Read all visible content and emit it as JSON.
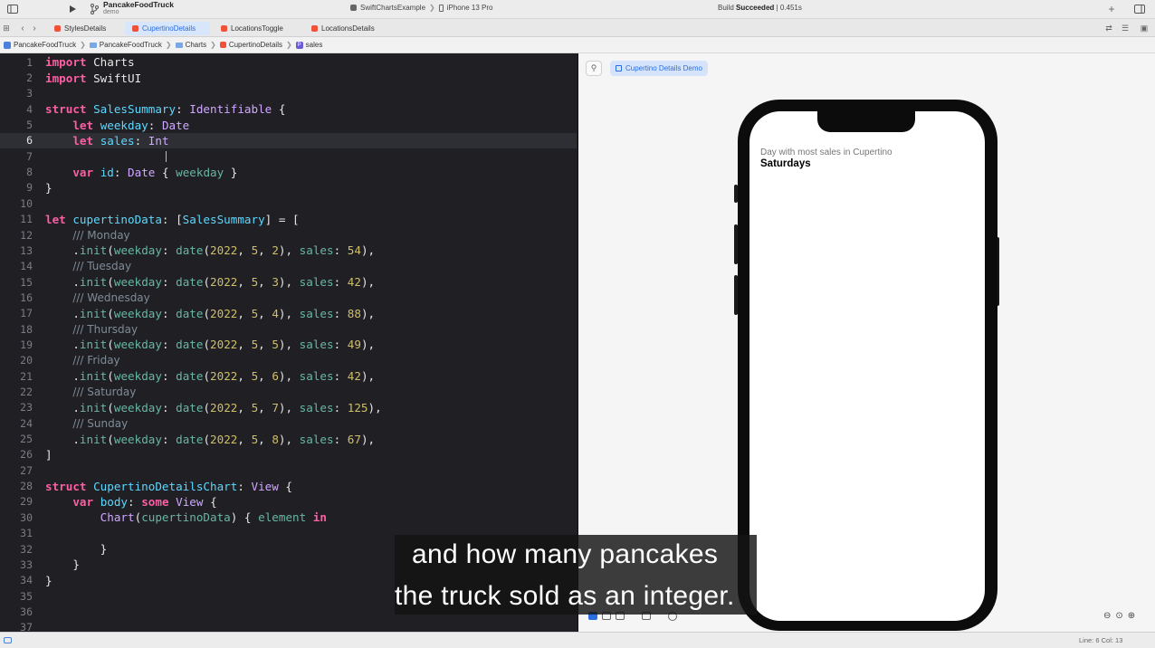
{
  "toolbar": {
    "project_name": "PancakeFoodTruck",
    "branch": "demo",
    "scheme": "SwiftChartsExample",
    "device": "iPhone 13 Pro",
    "build_status_prefix": "Build",
    "build_status_result": "Succeeded",
    "build_time": "| 0.451s"
  },
  "tabs": [
    {
      "label": "StylesDetails",
      "active": false
    },
    {
      "label": "CupertinoDetails",
      "active": true
    },
    {
      "label": "LocationsToggle",
      "active": false
    },
    {
      "label": "LocationsDetails",
      "active": false
    }
  ],
  "breadcrumbs": [
    "PancakeFoodTruck",
    "PancakeFoodTruck",
    "Charts",
    "CupertinoDetails",
    "sales"
  ],
  "editor": {
    "current_line": 6,
    "lines": [
      {
        "n": "1",
        "code": [
          [
            "kw",
            "import"
          ],
          [
            "pl",
            " Charts"
          ]
        ]
      },
      {
        "n": "2",
        "code": [
          [
            "kw",
            "import"
          ],
          [
            "pl",
            " SwiftUI"
          ]
        ]
      },
      {
        "n": "3",
        "code": []
      },
      {
        "n": "4",
        "code": [
          [
            "kw",
            "struct"
          ],
          [
            "pl",
            " "
          ],
          [
            "ty",
            "SalesSummary"
          ],
          [
            "pl",
            ": "
          ],
          [
            "ty2",
            "Identifiable"
          ],
          [
            "pl",
            " {"
          ]
        ]
      },
      {
        "n": "5",
        "code": [
          [
            "pl",
            "    "
          ],
          [
            "kw",
            "let"
          ],
          [
            "pl",
            " "
          ],
          [
            "ty",
            "weekday"
          ],
          [
            "pl",
            ": "
          ],
          [
            "ty2",
            "Date"
          ]
        ]
      },
      {
        "n": "6",
        "code": [
          [
            "pl",
            "    "
          ],
          [
            "kw",
            "let"
          ],
          [
            "pl",
            " "
          ],
          [
            "ty",
            "sales"
          ],
          [
            "pl",
            ": "
          ],
          [
            "ty2",
            "Int"
          ]
        ]
      },
      {
        "n": "7",
        "code": []
      },
      {
        "n": "8",
        "code": [
          [
            "pl",
            "    "
          ],
          [
            "kw",
            "var"
          ],
          [
            "pl",
            " "
          ],
          [
            "ty",
            "id"
          ],
          [
            "pl",
            ": "
          ],
          [
            "ty2",
            "Date"
          ],
          [
            "pl",
            " { "
          ],
          [
            "pr",
            "weekday"
          ],
          [
            "pl",
            " }"
          ]
        ]
      },
      {
        "n": "9",
        "code": [
          [
            "pl",
            "}"
          ]
        ]
      },
      {
        "n": "10",
        "code": []
      },
      {
        "n": "11",
        "code": [
          [
            "kw",
            "let"
          ],
          [
            "pl",
            " "
          ],
          [
            "ty",
            "cupertinoData"
          ],
          [
            "pl",
            ": ["
          ],
          [
            "ty",
            "SalesSummary"
          ],
          [
            "pl",
            "] = ["
          ]
        ]
      },
      {
        "n": "12",
        "code": [
          [
            "pl",
            "    "
          ],
          [
            "cm",
            "/// Monday"
          ]
        ]
      },
      {
        "n": "13",
        "code": [
          [
            "pl",
            "    ."
          ],
          [
            "pr",
            "init"
          ],
          [
            "pl",
            "("
          ],
          [
            "pr",
            "weekday"
          ],
          [
            "pl",
            ": "
          ],
          [
            "pr",
            "date"
          ],
          [
            "pl",
            "("
          ],
          [
            "num",
            "2022"
          ],
          [
            "pl",
            ", "
          ],
          [
            "num",
            "5"
          ],
          [
            "pl",
            ", "
          ],
          [
            "num",
            "2"
          ],
          [
            "pl",
            "), "
          ],
          [
            "pr",
            "sales"
          ],
          [
            "pl",
            ": "
          ],
          [
            "num",
            "54"
          ],
          [
            "pl",
            "),"
          ]
        ]
      },
      {
        "n": "14",
        "code": [
          [
            "pl",
            "    "
          ],
          [
            "cm",
            "/// Tuesday"
          ]
        ]
      },
      {
        "n": "15",
        "code": [
          [
            "pl",
            "    ."
          ],
          [
            "pr",
            "init"
          ],
          [
            "pl",
            "("
          ],
          [
            "pr",
            "weekday"
          ],
          [
            "pl",
            ": "
          ],
          [
            "pr",
            "date"
          ],
          [
            "pl",
            "("
          ],
          [
            "num",
            "2022"
          ],
          [
            "pl",
            ", "
          ],
          [
            "num",
            "5"
          ],
          [
            "pl",
            ", "
          ],
          [
            "num",
            "3"
          ],
          [
            "pl",
            "), "
          ],
          [
            "pr",
            "sales"
          ],
          [
            "pl",
            ": "
          ],
          [
            "num",
            "42"
          ],
          [
            "pl",
            "),"
          ]
        ]
      },
      {
        "n": "16",
        "code": [
          [
            "pl",
            "    "
          ],
          [
            "cm",
            "/// Wednesday"
          ]
        ]
      },
      {
        "n": "17",
        "code": [
          [
            "pl",
            "    ."
          ],
          [
            "pr",
            "init"
          ],
          [
            "pl",
            "("
          ],
          [
            "pr",
            "weekday"
          ],
          [
            "pl",
            ": "
          ],
          [
            "pr",
            "date"
          ],
          [
            "pl",
            "("
          ],
          [
            "num",
            "2022"
          ],
          [
            "pl",
            ", "
          ],
          [
            "num",
            "5"
          ],
          [
            "pl",
            ", "
          ],
          [
            "num",
            "4"
          ],
          [
            "pl",
            "), "
          ],
          [
            "pr",
            "sales"
          ],
          [
            "pl",
            ": "
          ],
          [
            "num",
            "88"
          ],
          [
            "pl",
            "),"
          ]
        ]
      },
      {
        "n": "18",
        "code": [
          [
            "pl",
            "    "
          ],
          [
            "cm",
            "/// Thursday"
          ]
        ]
      },
      {
        "n": "19",
        "code": [
          [
            "pl",
            "    ."
          ],
          [
            "pr",
            "init"
          ],
          [
            "pl",
            "("
          ],
          [
            "pr",
            "weekday"
          ],
          [
            "pl",
            ": "
          ],
          [
            "pr",
            "date"
          ],
          [
            "pl",
            "("
          ],
          [
            "num",
            "2022"
          ],
          [
            "pl",
            ", "
          ],
          [
            "num",
            "5"
          ],
          [
            "pl",
            ", "
          ],
          [
            "num",
            "5"
          ],
          [
            "pl",
            "), "
          ],
          [
            "pr",
            "sales"
          ],
          [
            "pl",
            ": "
          ],
          [
            "num",
            "49"
          ],
          [
            "pl",
            "),"
          ]
        ]
      },
      {
        "n": "20",
        "code": [
          [
            "pl",
            "    "
          ],
          [
            "cm",
            "/// Friday"
          ]
        ]
      },
      {
        "n": "21",
        "code": [
          [
            "pl",
            "    ."
          ],
          [
            "pr",
            "init"
          ],
          [
            "pl",
            "("
          ],
          [
            "pr",
            "weekday"
          ],
          [
            "pl",
            ": "
          ],
          [
            "pr",
            "date"
          ],
          [
            "pl",
            "("
          ],
          [
            "num",
            "2022"
          ],
          [
            "pl",
            ", "
          ],
          [
            "num",
            "5"
          ],
          [
            "pl",
            ", "
          ],
          [
            "num",
            "6"
          ],
          [
            "pl",
            "), "
          ],
          [
            "pr",
            "sales"
          ],
          [
            "pl",
            ": "
          ],
          [
            "num",
            "42"
          ],
          [
            "pl",
            "),"
          ]
        ]
      },
      {
        "n": "22",
        "code": [
          [
            "pl",
            "    "
          ],
          [
            "cm",
            "/// Saturday"
          ]
        ]
      },
      {
        "n": "23",
        "code": [
          [
            "pl",
            "    ."
          ],
          [
            "pr",
            "init"
          ],
          [
            "pl",
            "("
          ],
          [
            "pr",
            "weekday"
          ],
          [
            "pl",
            ": "
          ],
          [
            "pr",
            "date"
          ],
          [
            "pl",
            "("
          ],
          [
            "num",
            "2022"
          ],
          [
            "pl",
            ", "
          ],
          [
            "num",
            "5"
          ],
          [
            "pl",
            ", "
          ],
          [
            "num",
            "7"
          ],
          [
            "pl",
            "), "
          ],
          [
            "pr",
            "sales"
          ],
          [
            "pl",
            ": "
          ],
          [
            "num",
            "125"
          ],
          [
            "pl",
            "),"
          ]
        ]
      },
      {
        "n": "24",
        "code": [
          [
            "pl",
            "    "
          ],
          [
            "cm",
            "/// Sunday"
          ]
        ]
      },
      {
        "n": "25",
        "code": [
          [
            "pl",
            "    ."
          ],
          [
            "pr",
            "init"
          ],
          [
            "pl",
            "("
          ],
          [
            "pr",
            "weekday"
          ],
          [
            "pl",
            ": "
          ],
          [
            "pr",
            "date"
          ],
          [
            "pl",
            "("
          ],
          [
            "num",
            "2022"
          ],
          [
            "pl",
            ", "
          ],
          [
            "num",
            "5"
          ],
          [
            "pl",
            ", "
          ],
          [
            "num",
            "8"
          ],
          [
            "pl",
            "), "
          ],
          [
            "pr",
            "sales"
          ],
          [
            "pl",
            ": "
          ],
          [
            "num",
            "67"
          ],
          [
            "pl",
            "),"
          ]
        ]
      },
      {
        "n": "26",
        "code": [
          [
            "pl",
            "]"
          ]
        ]
      },
      {
        "n": "27",
        "code": []
      },
      {
        "n": "28",
        "code": [
          [
            "kw",
            "struct"
          ],
          [
            "pl",
            " "
          ],
          [
            "ty",
            "CupertinoDetailsChart"
          ],
          [
            "pl",
            ": "
          ],
          [
            "ty2",
            "View"
          ],
          [
            "pl",
            " {"
          ]
        ]
      },
      {
        "n": "29",
        "code": [
          [
            "pl",
            "    "
          ],
          [
            "kw",
            "var"
          ],
          [
            "pl",
            " "
          ],
          [
            "ty",
            "body"
          ],
          [
            "pl",
            ": "
          ],
          [
            "kw",
            "some"
          ],
          [
            "pl",
            " "
          ],
          [
            "ty2",
            "View"
          ],
          [
            "pl",
            " {"
          ]
        ]
      },
      {
        "n": "30",
        "code": [
          [
            "pl",
            "        "
          ],
          [
            "ty2",
            "Chart"
          ],
          [
            "pl",
            "("
          ],
          [
            "pr",
            "cupertinoData"
          ],
          [
            "pl",
            ") { "
          ],
          [
            "pr",
            "element"
          ],
          [
            "pl",
            " "
          ],
          [
            "kw",
            "in"
          ]
        ]
      },
      {
        "n": "31",
        "code": []
      },
      {
        "n": "32",
        "code": [
          [
            "pl",
            "        }"
          ]
        ]
      },
      {
        "n": "33",
        "code": [
          [
            "pl",
            "    }"
          ]
        ]
      },
      {
        "n": "34",
        "code": [
          [
            "pl",
            "}"
          ]
        ]
      },
      {
        "n": "35",
        "code": []
      },
      {
        "n": "36",
        "code": []
      },
      {
        "n": "37",
        "code": []
      }
    ]
  },
  "canvas": {
    "preview_label": "Cupertino Details Demo",
    "preview_caption": "Day with most sales in Cupertino",
    "preview_value": "Saturdays"
  },
  "subtitle": {
    "line1": "and how many pancakes",
    "line2": "the truck sold as an integer."
  },
  "status": {
    "cursor": "Line: 6  Col: 13"
  },
  "colors": {
    "editor_bg": "#1f1f24",
    "keyword": "#fc5fa3",
    "type": "#5dd8ff",
    "number": "#d0bf69",
    "accent": "#2a6de0"
  }
}
